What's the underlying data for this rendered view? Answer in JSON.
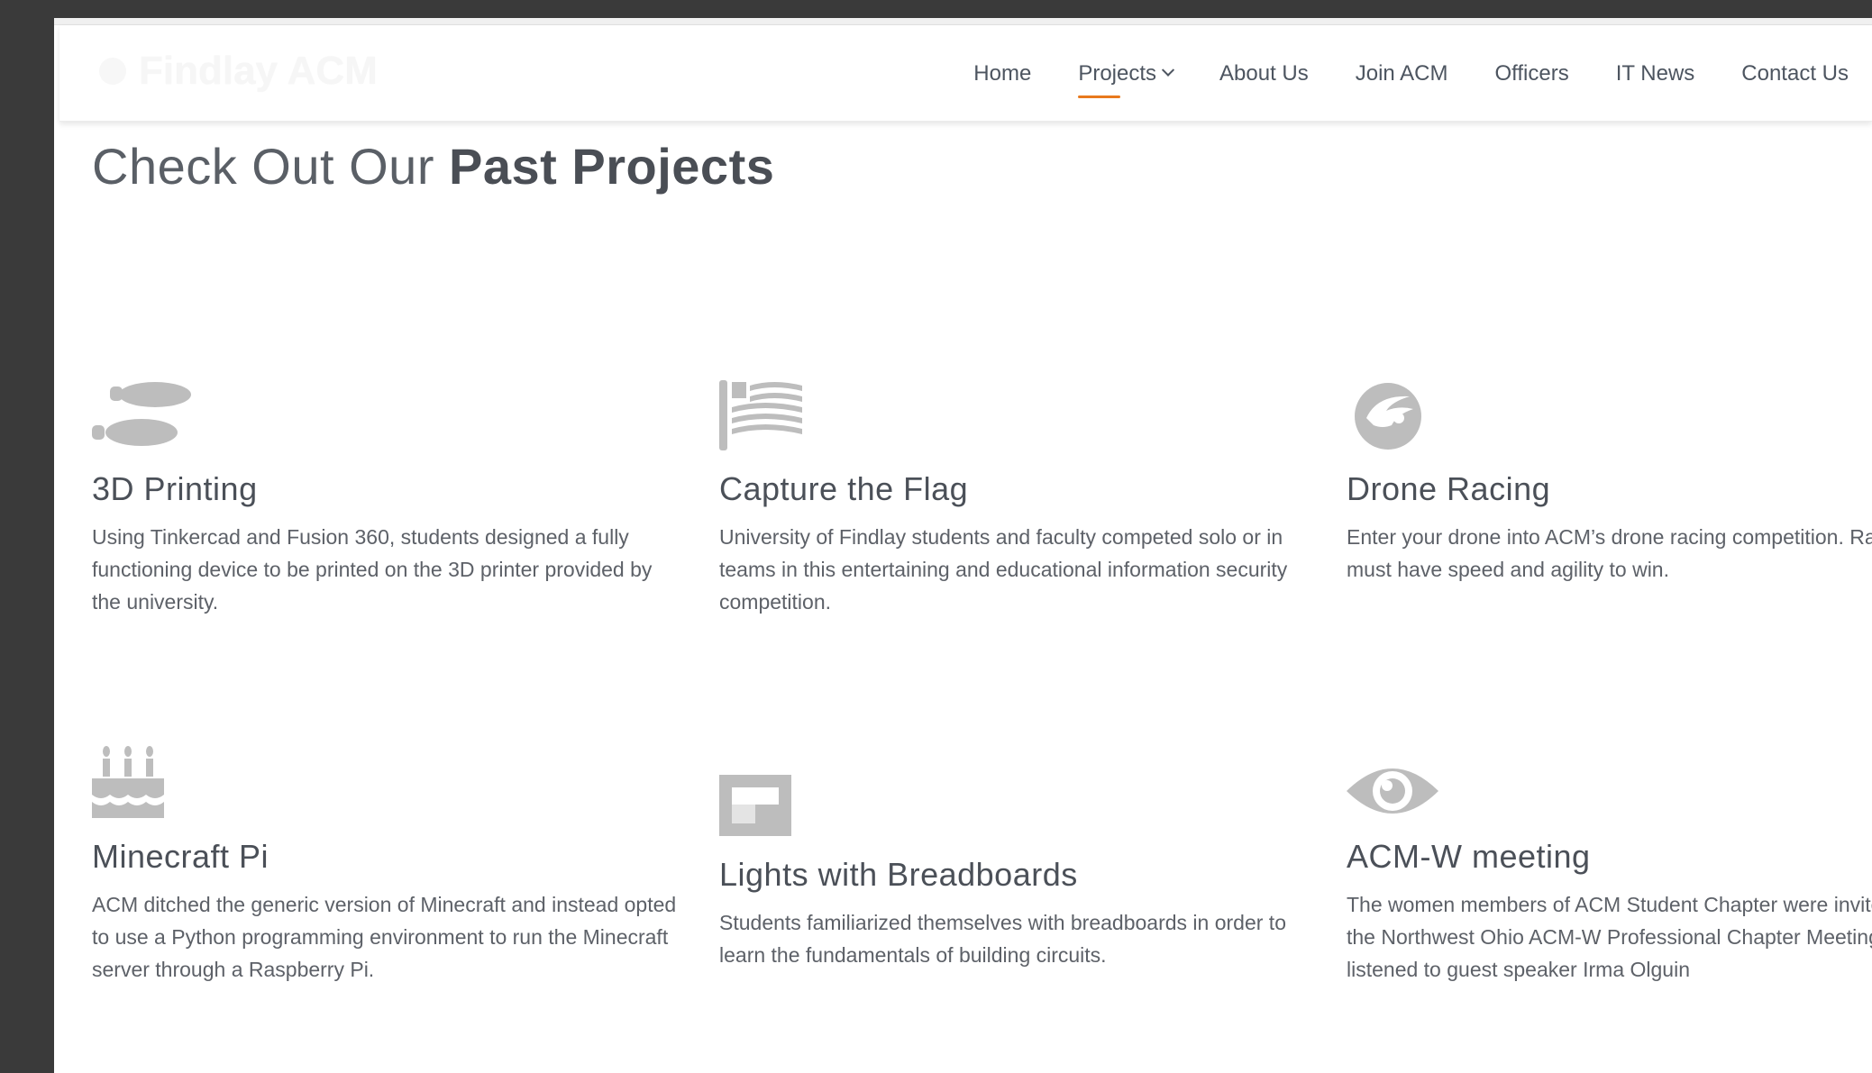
{
  "site": {
    "logo_text": "Findlay ACM"
  },
  "nav": {
    "home": "Home",
    "projects": "Projects",
    "about": "About Us",
    "join": "Join ACM",
    "officers": "Officers",
    "news": "IT News",
    "contact": "Contact Us"
  },
  "title": {
    "light": "Check Out Our ",
    "bold": "Past Projects"
  },
  "projects": [
    {
      "title": "3D Printing",
      "icon": "shoe-prints-icon",
      "desc": "Using Tinkercad and Fusion 360, students designed a fully functioning device to be printed on the 3D printer provided by the university."
    },
    {
      "title": "Capture the Flag",
      "icon": "flag-icon",
      "desc": "University of Findlay students and faculty competed solo or in teams in this entertaining and educational information security competition."
    },
    {
      "title": "Drone Racing",
      "icon": "rebel-logo-icon",
      "desc": "Enter your drone into ACM’s drone racing competition. Racers must have speed and agility to win."
    },
    {
      "title": "Minecraft Pi",
      "icon": "birthday-cake-icon",
      "desc": "ACM ditched the generic version of Minecraft and instead opted to use a Python programming environment to run the Minecraft server through a Raspberry Pi."
    },
    {
      "title": "Lights with Breadboards",
      "icon": "flipboard-icon",
      "desc": "Students familiarized themselves with breadboards in order to learn the fundamentals of building circuits."
    },
    {
      "title": "ACM-W meeting",
      "icon": "eye-icon",
      "desc": "The women members of ACM Student Chapter were invited to the Northwest Ohio ACM-W Professional Chapter Meeting and listened to guest speaker Irma Olguin"
    }
  ],
  "colors": {
    "accent": "#e8791d",
    "icon_gray": "#bdbdbd",
    "text": "#5d6168"
  }
}
